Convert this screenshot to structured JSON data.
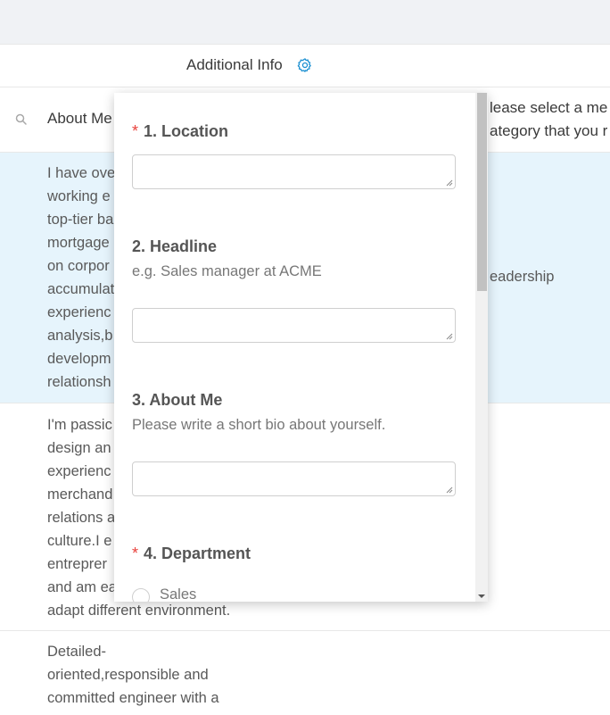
{
  "table": {
    "column_title": "Additional Info",
    "about_label": "About Me",
    "hint_lines": [
      "lease select a me",
      "ategory that you r"
    ],
    "rows": [
      {
        "lines": [
          "I have ove",
          "working e",
          "top-tier ba",
          "mortgage",
          "on corpor",
          "accumulat",
          "experienc",
          "analysis,b",
          "developm",
          "relationsh"
        ],
        "right": "eadership"
      },
      {
        "lines": [
          "I'm passic",
          "design an",
          "experienc",
          "merchand",
          "relations a",
          "culture.I e",
          "entreprer",
          "and am ea",
          "adapt different environment."
        ]
      },
      {
        "lines": [
          "Detailed-",
          "oriented,responsible and",
          "committed engineer with a"
        ]
      }
    ]
  },
  "form": {
    "q1": {
      "required": "*",
      "label": "1. Location"
    },
    "q2": {
      "label": "2. Headline",
      "description": "e.g. Sales manager at ACME"
    },
    "q3": {
      "label": "3. About Me",
      "description": "Please write a short bio about yourself."
    },
    "q4": {
      "required": "*",
      "label": "4. Department",
      "option": "Sales"
    }
  },
  "colors": {
    "accent": "#1a8fd1",
    "required": "#e8413c",
    "selected_row": "#e6f4fc"
  },
  "icons": {
    "settings": "gear-icon",
    "search": "search-icon"
  }
}
